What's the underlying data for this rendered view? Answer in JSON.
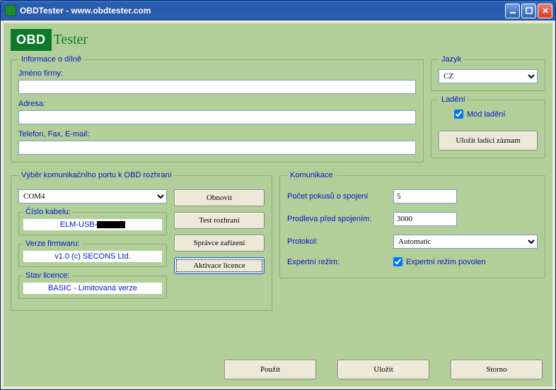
{
  "window": {
    "title": "OBDTester - www.obdtester.com"
  },
  "logo": {
    "box": "OBD",
    "text": "Tester"
  },
  "workshop": {
    "legend": "Informace o dílně",
    "companyLabel": "Jméno firmy:",
    "companyValue": "",
    "addressLabel": "Adresa:",
    "addressValue": "",
    "contactLabel": "Telefon, Fax, E-mail:",
    "contactValue": ""
  },
  "language": {
    "legend": "Jazyk",
    "value": "CZ"
  },
  "debug": {
    "legend": "Ladění",
    "modeLabel": "Mód ladění",
    "modeChecked": true,
    "saveBtn": "Uložit ladící záznam"
  },
  "port": {
    "legend": "Výběr komunikačního portu k OBD rozhraní",
    "selected": "COM4",
    "refreshBtn": "Obnovit",
    "testBtn": "Test rozhraní",
    "devmgrBtn": "Správce zařízení",
    "activateBtn": "Aktivace licence",
    "cable": {
      "legend": "Číslo kabelu:",
      "value": "ELM-USB-"
    },
    "fw": {
      "legend": "Verze firmwaru:",
      "value": "v1.0 (c) SECONS Ltd."
    },
    "lic": {
      "legend": "Stav licence:",
      "value": "BASIC - Limitovaná verze"
    }
  },
  "comm": {
    "legend": "Komunikace",
    "attemptsLabel": "Počet pokusů o spojení",
    "attemptsValue": "5",
    "delayLabel": "Prodleva před spojením:",
    "delayValue": "3000",
    "protocolLabel": "Protokol:",
    "protocolValue": "Automatic",
    "expertLabel": "Expertní režim:",
    "expertCheckLabel": "Expertní režim povolen",
    "expertChecked": true
  },
  "buttons": {
    "apply": "Použít",
    "save": "Uložit",
    "cancel": "Storno"
  }
}
